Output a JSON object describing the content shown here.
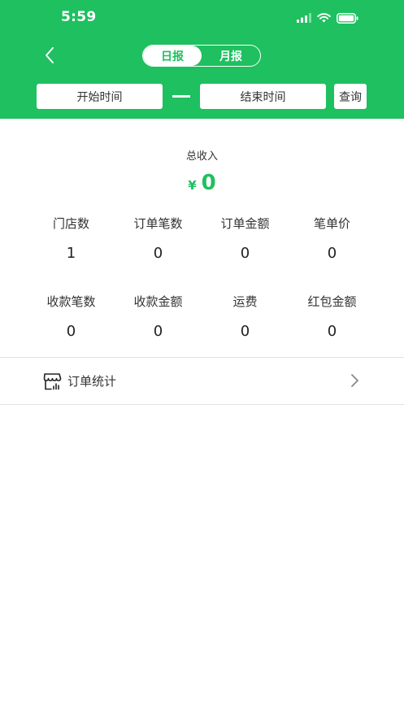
{
  "status_bar": {
    "time": "5:59",
    "icons": [
      "cellular-signal-icon",
      "wifi-icon",
      "battery-icon"
    ]
  },
  "header": {
    "background_color": "#1ec05f",
    "back_icon": "chevron-left-icon",
    "tabs": [
      {
        "label": "日报",
        "active": true
      },
      {
        "label": "月报",
        "active": false
      }
    ],
    "start_time_placeholder": "开始时间",
    "end_time_placeholder": "结束时间",
    "query_label": "查询"
  },
  "summary": {
    "total_label": "总收入",
    "currency": "¥",
    "total_value": "0",
    "accent_color": "#1ec05f"
  },
  "stats": [
    [
      {
        "label": "门店数",
        "value": "1"
      },
      {
        "label": "订单笔数",
        "value": "0"
      },
      {
        "label": "订单金额",
        "value": "0"
      },
      {
        "label": "笔单价",
        "value": "0"
      }
    ],
    [
      {
        "label": "收款笔数",
        "value": "0"
      },
      {
        "label": "收款金额",
        "value": "0"
      },
      {
        "label": "运费",
        "value": "0"
      },
      {
        "label": "红包金额",
        "value": "0"
      }
    ]
  ],
  "order_stats": {
    "icon": "store-chart-icon",
    "label": "订单统计",
    "chevron_icon": "chevron-right-icon"
  }
}
